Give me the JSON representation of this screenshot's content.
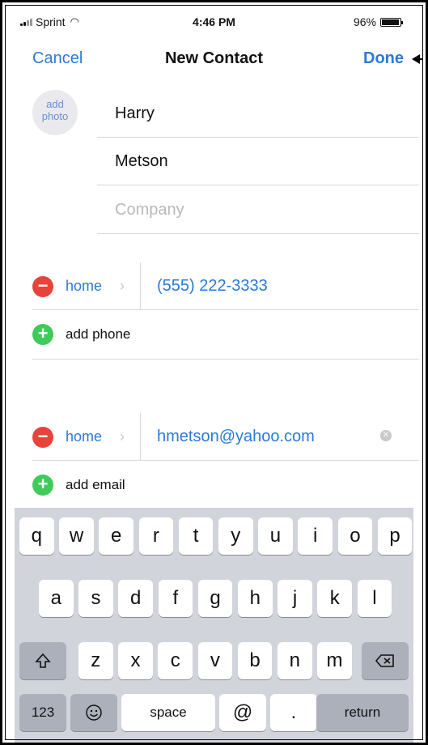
{
  "status_bar": {
    "carrier": "Sprint",
    "time": "4:46 PM",
    "battery": "96%",
    "battery_level": 0.96
  },
  "nav": {
    "cancel_label": "Cancel",
    "title": "New Contact",
    "done_label": "Done"
  },
  "photo": {
    "label": "add photo"
  },
  "fields": {
    "first_name": "Harry",
    "last_name": "Metson",
    "company_placeholder": "Company"
  },
  "phone": {
    "type": "home",
    "value": "(555) 222-3333",
    "add_label": "add phone"
  },
  "email": {
    "type": "home",
    "value": "hmetson@yahoo.com",
    "add_label": "add email"
  },
  "keyboard": {
    "row1": [
      "q",
      "w",
      "e",
      "r",
      "t",
      "y",
      "u",
      "i",
      "o",
      "p"
    ],
    "row2": [
      "a",
      "s",
      "d",
      "f",
      "g",
      "h",
      "j",
      "k",
      "l"
    ],
    "row3": [
      "z",
      "x",
      "c",
      "v",
      "b",
      "n",
      "m"
    ],
    "numbers_label": "123",
    "space_label": "space",
    "at_label": "@",
    "dot_label": ".",
    "return_label": "return",
    "icons": {
      "shift": "shift-icon",
      "delete": "delete-icon",
      "emoji": "emoji-icon"
    }
  },
  "colors": {
    "accent": "#2a7ad8",
    "delete_red": "#e8433b",
    "add_green": "#3ecb5a",
    "keyboard_bg": "#d1d4da"
  }
}
